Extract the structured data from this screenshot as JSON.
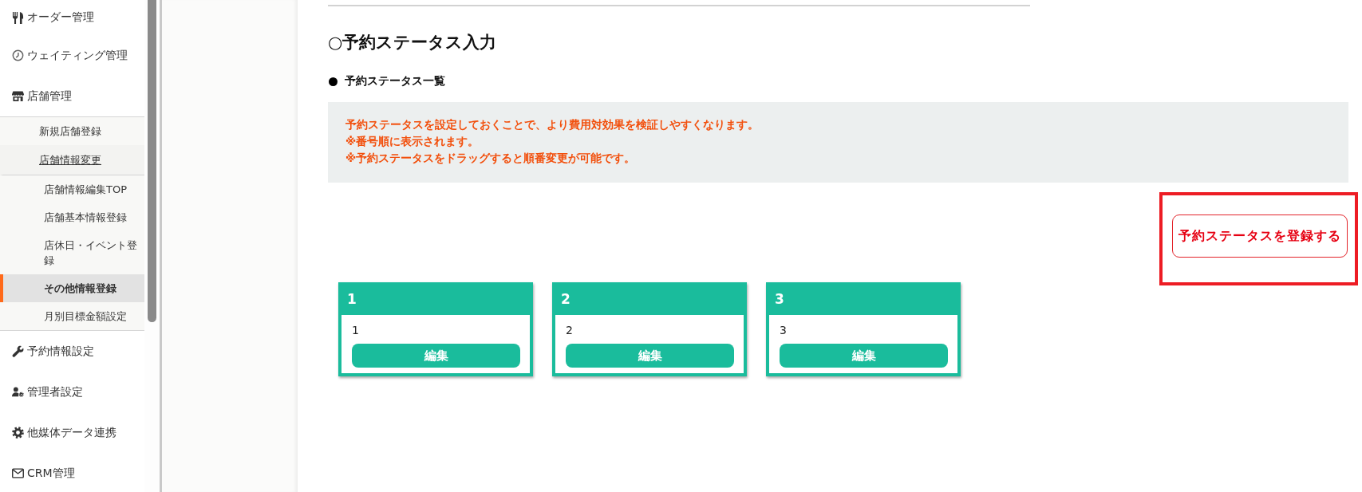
{
  "sidebar": {
    "items": [
      {
        "label": "オーダー管理",
        "selected": false
      },
      {
        "label": "ウェイティング管理",
        "selected": false
      },
      {
        "label": "店舗管理",
        "selected": false,
        "children": [
          {
            "label": "新規店舗登録",
            "expanded": false,
            "selected": false
          },
          {
            "label": "店舗情報変更",
            "expanded": true,
            "selected": false,
            "children": [
              {
                "label": "店舗情報編集TOP",
                "selected": false
              },
              {
                "label": "店舗基本情報登録",
                "selected": false
              },
              {
                "label": "店休日・イベント登録",
                "selected": false
              },
              {
                "label": "その他情報登録",
                "selected": true
              },
              {
                "label": "月別目標金額設定",
                "selected": false
              }
            ]
          }
        ]
      },
      {
        "label": "予約情報設定",
        "selected": false
      },
      {
        "label": "管理者設定",
        "selected": false
      },
      {
        "label": "他媒体データ連携",
        "selected": false
      },
      {
        "label": "CRM管理",
        "selected": false
      }
    ]
  },
  "page": {
    "title": "○予約ステータス入力",
    "section_title": "予約ステータス一覧",
    "notice": [
      "予約ステータスを設定しておくことで、より費用対効果を検証しやすくなります。",
      "※番号順に表示されます。",
      "※予約ステータスをドラッグすると順番変更が可能です。"
    ],
    "register_button": {
      "label": "予約ステータスを登録する",
      "highlighted": true
    },
    "status_cards": [
      {
        "number": "1",
        "name": "1",
        "edit_button": "編集"
      },
      {
        "number": "2",
        "name": "2",
        "edit_button": "編集"
      },
      {
        "number": "3",
        "name": "3",
        "edit_button": "編集"
      }
    ]
  }
}
